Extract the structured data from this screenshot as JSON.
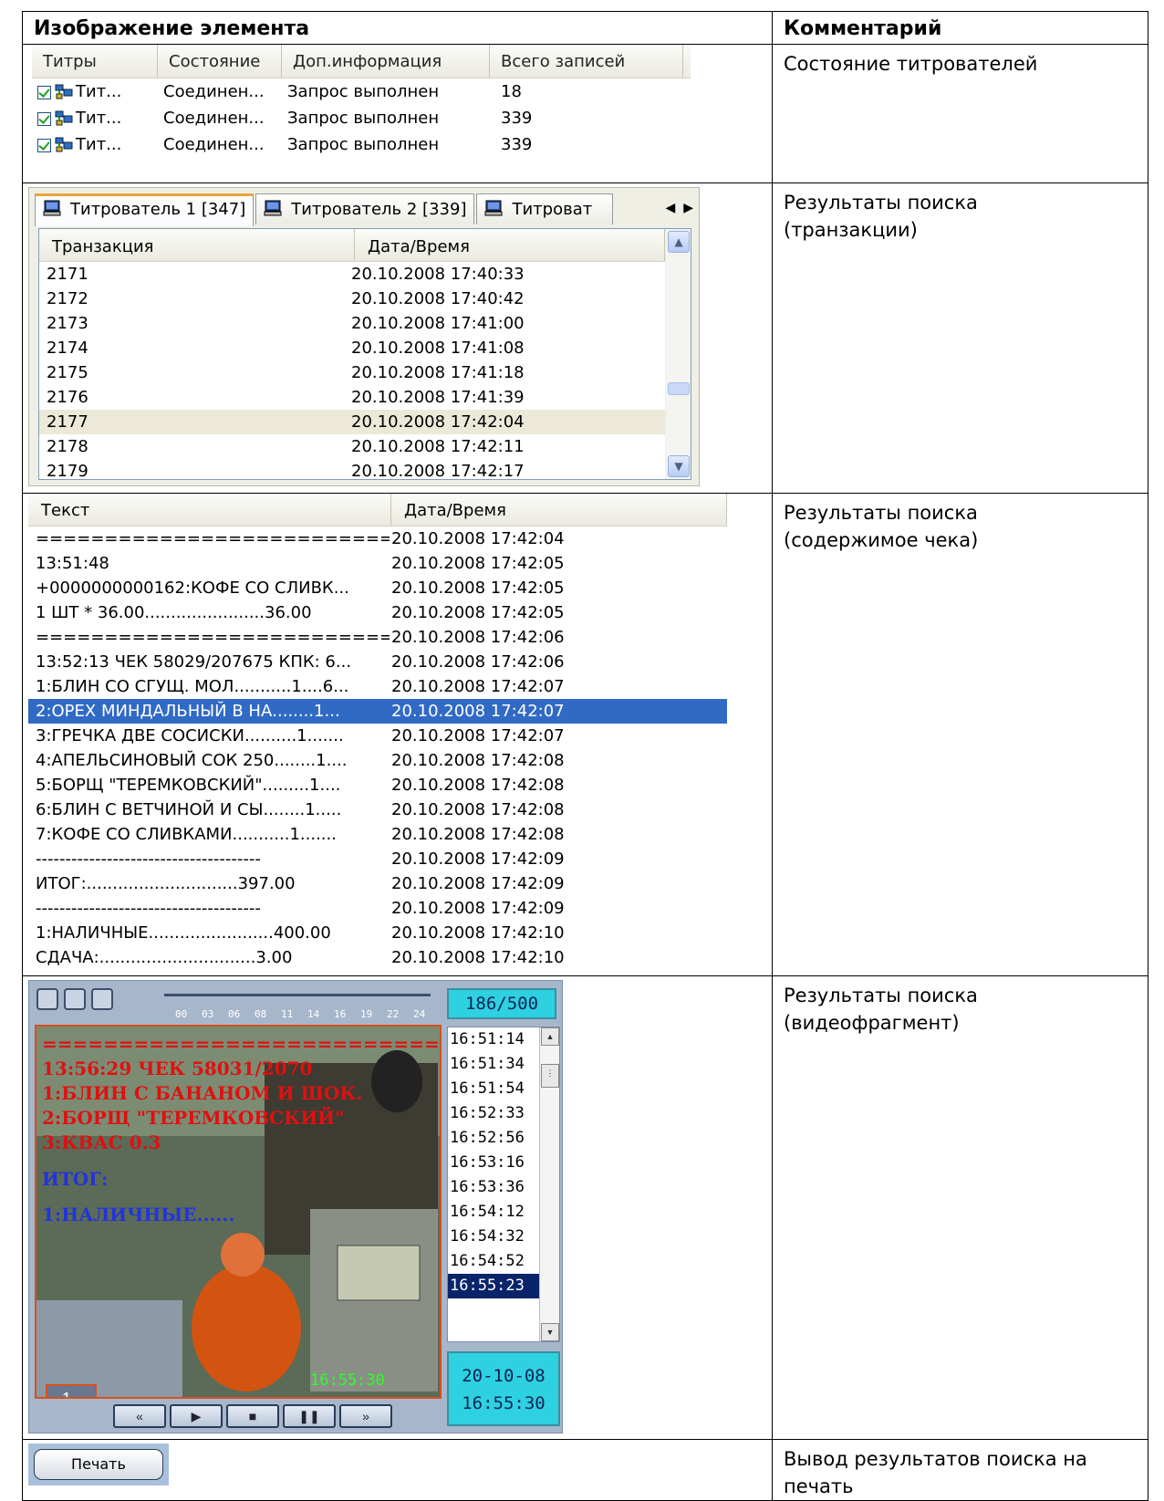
{
  "header": {
    "col_image": "Изображение элемента",
    "col_comment": "Комментарий"
  },
  "state_grid": {
    "columns": [
      "Титры",
      "Состояние",
      "Доп.информация",
      "Всего записей"
    ],
    "rows": [
      {
        "name": "Тит...",
        "state": "Соединен...",
        "info": "Запрос выполнен",
        "total": "18"
      },
      {
        "name": "Тит...",
        "state": "Соединен...",
        "info": "Запрос выполнен",
        "total": "339"
      },
      {
        "name": "Тит...",
        "state": "Соединен...",
        "info": "Запрос выполнен",
        "total": "339"
      }
    ],
    "comment": "Состояние титрователей"
  },
  "transactions": {
    "tabs": [
      "Титрователь 1 [347]",
      "Титрователь 2 [339]",
      "Титроват"
    ],
    "columns": [
      "Транзакция",
      "Дата/Время"
    ],
    "rows": [
      [
        "2171",
        "20.10.2008 17:40:33"
      ],
      [
        "2172",
        "20.10.2008 17:40:42"
      ],
      [
        "2173",
        "20.10.2008 17:41:00"
      ],
      [
        "2174",
        "20.10.2008 17:41:08"
      ],
      [
        "2175",
        "20.10.2008 17:41:18"
      ],
      [
        "2176",
        "20.10.2008 17:41:39"
      ],
      [
        "2177",
        "20.10.2008 17:42:04"
      ],
      [
        "2178",
        "20.10.2008 17:42:11"
      ],
      [
        "2179",
        "20.10.2008 17:42:17"
      ]
    ],
    "comment_line1": "Результаты поиска",
    "comment_line2": "(транзакции)"
  },
  "receipt": {
    "columns": [
      "Текст",
      "Дата/Время"
    ],
    "rows": [
      [
        "==============================...",
        "20.10.2008 17:42:04"
      ],
      [
        "13:51:48",
        "20.10.2008 17:42:05"
      ],
      [
        "+0000000000162:КОФЕ  СО СЛИВК...",
        "20.10.2008 17:42:05"
      ],
      [
        "1 ШТ * 36.00.......................36.00",
        "20.10.2008 17:42:05"
      ],
      [
        "==============================...",
        "20.10.2008 17:42:06"
      ],
      [
        "13:52:13  ЧЕК 58029/207675 КПК: 6...",
        "20.10.2008 17:42:06"
      ],
      [
        "1:БЛИН СО СГУЩ. МОЛ...........1....6...",
        "20.10.2008 17:42:07"
      ],
      [
        "2:ОРЕХ МИНДАЛЬНЫЙ В НА........1...",
        "20.10.2008 17:42:07"
      ],
      [
        "3:ГРЕЧКА ДВЕ СОСИСКИ..........1.......",
        "20.10.2008 17:42:07"
      ],
      [
        "4:АПЕЛЬСИНОВЫЙ СОК 250........1....",
        "20.10.2008 17:42:08"
      ],
      [
        "5:БОРЩ \"ТЕРЕМКОВСКИЙ\".........1....",
        "20.10.2008 17:42:08"
      ],
      [
        "6:БЛИН С ВЕТЧИНОЙ И СЫ........1.....",
        "20.10.2008 17:42:08"
      ],
      [
        "7:КОФЕ  СО СЛИВКАМИ...........1.......",
        "20.10.2008 17:42:08"
      ],
      [
        "--------------------------------------",
        "20.10.2008 17:42:09"
      ],
      [
        "ИТОГ:.............................397.00",
        "20.10.2008 17:42:09"
      ],
      [
        "--------------------------------------",
        "20.10.2008 17:42:09"
      ],
      [
        "1:НАЛИЧНЫЕ........................400.00",
        "20.10.2008 17:42:10"
      ],
      [
        "СДАЧА:..............................3.00",
        "20.10.2008 17:42:10"
      ]
    ],
    "comment_line1": "Результаты поиска",
    "comment_line2": "(содержимое чека)"
  },
  "video": {
    "counter": "186/500",
    "timeline_labels": [
      "00",
      "03",
      "06",
      "08",
      "11",
      "14",
      "16",
      "19",
      "22",
      "24"
    ],
    "overlay_lines": [
      "==============================",
      "13:56:29  ЧЕК 58031/2070",
      "1:БЛИН С БАНАНОМ И ШОК.",
      "2:БОРЩ \"ТЕРЕМКОВСКИЙ\"",
      "3:КВАС 0.3",
      "ИТОГ:",
      "1:НАЛИЧНЫЕ......"
    ],
    "camera_number": "1",
    "stamp_time": "16:55:30",
    "times": [
      "16:51:14",
      "16:51:34",
      "16:51:54",
      "16:52:33",
      "16:52:56",
      "16:53:16",
      "16:53:36",
      "16:54:12",
      "16:54:32",
      "16:54:52",
      "16:55:23"
    ],
    "date": "20-10-08",
    "time": "16:55:30",
    "comment_line1": "Результаты поиска",
    "comment_line2": "(видеофрагмент)"
  },
  "print": {
    "label": "Печать",
    "comment_line1": "Вывод результатов поиска на",
    "comment_line2": "печать"
  }
}
